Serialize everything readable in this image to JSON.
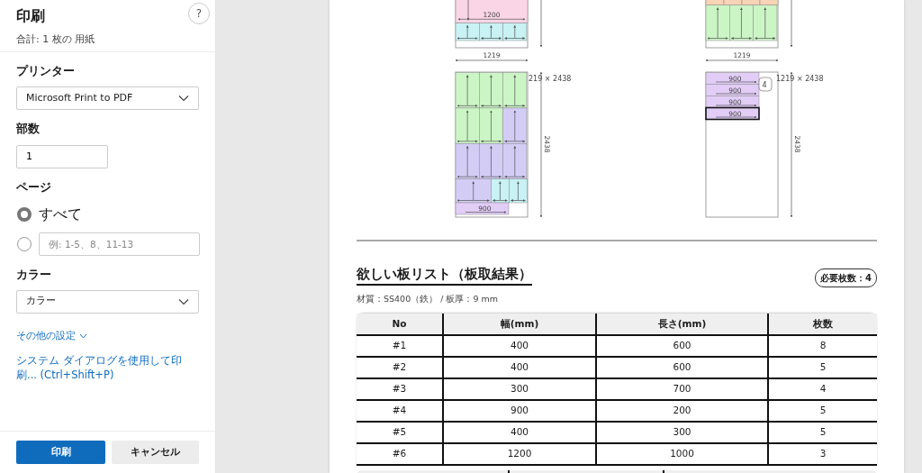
{
  "print_panel": {
    "title": "印刷",
    "summary": "合計: 1 枚の 用紙",
    "help": "?",
    "printer": {
      "label": "プリンター",
      "value": "Microsoft Print to PDF"
    },
    "copies": {
      "label": "部数",
      "value": "1"
    },
    "pages": {
      "label": "ページ",
      "options": [
        {
          "label": "すべて",
          "selected": true
        },
        {
          "placeholder": "例: 1-5、8、11-13",
          "selected": false
        }
      ]
    },
    "color": {
      "label": "カラー",
      "value": "カラー"
    },
    "more_settings": "その他の設定",
    "system_dialog": "システム ダイアログを使用して印刷... (Ctrl+Shift+P)",
    "buttons": [
      {
        "label": "印刷",
        "kind": "primary"
      },
      {
        "label": "キャンセル",
        "kind": "secondary"
      }
    ]
  },
  "preview": {
    "layouts": [
      {
        "upper_rows": [
          [
            {
              "kind": "cut",
              "w": "1200",
              "color": "#f9d5e5"
            }
          ],
          [
            {
              "kind": "short",
              "color": "#c8f2f4"
            },
            {
              "kind": "short",
              "color": "#c8f2f4"
            },
            {
              "kind": "short",
              "color": "#c8f2f4"
            }
          ]
        ],
        "width_label": "1219",
        "size_label": "219 × 2438",
        "height_label": "2438",
        "lower_rows": [
          [
            {
              "kind": "tall",
              "color": "#ccf5c6",
              "selected": false
            },
            {
              "kind": "tall",
              "color": "#ccf5c6",
              "selected": false
            },
            {
              "kind": "tall",
              "color": "#ccf5c6",
              "selected": false
            }
          ],
          [
            {
              "kind": "tall",
              "color": "#ccf5c6",
              "selected": false
            },
            {
              "kind": "tall",
              "color": "#ccf5c6",
              "selected": false
            },
            {
              "kind": "tall",
              "color": "#d3cdf6",
              "selected": false
            }
          ],
          [
            {
              "kind": "tall",
              "color": "#d3cdf6",
              "selected": false
            },
            {
              "kind": "tall",
              "color": "#d3cdf6",
              "selected": false
            },
            {
              "kind": "tall",
              "color": "#d3cdf6",
              "selected": false
            }
          ],
          [
            {
              "kind": "wide",
              "color": "#d3cdf6",
              "selected": false
            },
            {
              "kind": "narrow",
              "color": "#c8f2f4",
              "selected": false
            },
            {
              "kind": "narrow",
              "color": "#c8f2f4",
              "selected": false
            }
          ],
          [
            {
              "kind": "bar",
              "w": "900",
              "color": "#e2cdf7",
              "selected": false
            }
          ]
        ]
      },
      {
        "upper_rows": [
          [
            {
              "kind": "stub",
              "color": "#f9d3b5"
            },
            {
              "kind": "stub",
              "color": "#f9d3b5"
            },
            {
              "kind": "stub",
              "color": "#f9d3b5"
            },
            {
              "kind": "stub",
              "color": "#f9d3b5"
            }
          ],
          [
            {
              "kind": "tall",
              "color": "#ccf5c6"
            },
            {
              "kind": "tall",
              "color": "#ccf5c6"
            },
            {
              "kind": "tall",
              "color": "#ccf5c6"
            }
          ]
        ],
        "width_label": "1219",
        "size_label": "1219 × 2438",
        "height_label": "2438",
        "count_badge": "4",
        "lower_rows": [
          [
            {
              "kind": "bar",
              "w": "900",
              "color": "#e2cdf7",
              "selected": false
            }
          ],
          [
            {
              "kind": "bar",
              "w": "900",
              "color": "#e2cdf7",
              "selected": false
            }
          ],
          [
            {
              "kind": "bar",
              "w": "900",
              "color": "#e2cdf7",
              "selected": false
            }
          ],
          [
            {
              "kind": "bar",
              "w": "900",
              "color": "#e2cdf7",
              "selected": true
            }
          ]
        ]
      }
    ],
    "list": {
      "title": "欲しい板リスト（板取結果）",
      "required": "必要枚数：4",
      "material": "材質：SS400（鉄） / 板厚：9 mm",
      "columns": [
        "No",
        "幅(mm)",
        "長さ(mm)",
        "枚数"
      ],
      "rows": [
        [
          "#1",
          "400",
          "600",
          "8"
        ],
        [
          "#2",
          "400",
          "600",
          "5"
        ],
        [
          "#3",
          "300",
          "700",
          "4"
        ],
        [
          "#4",
          "900",
          "200",
          "5"
        ],
        [
          "#5",
          "400",
          "300",
          "5"
        ],
        [
          "#6",
          "1200",
          "1000",
          "3"
        ]
      ]
    }
  }
}
